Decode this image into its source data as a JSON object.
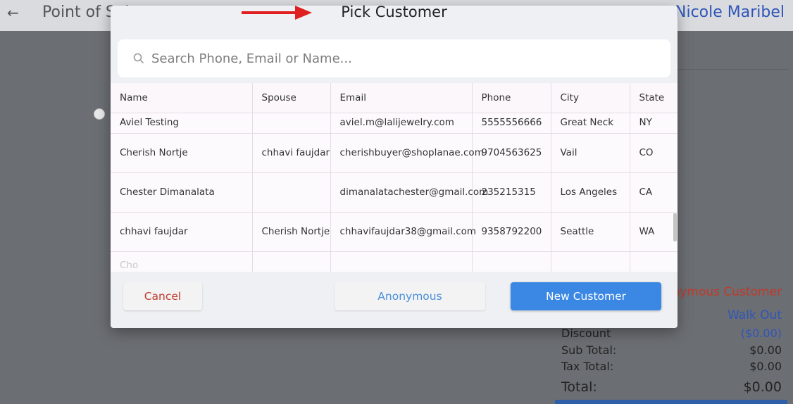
{
  "app": {
    "back_icon": "arrow-left-icon",
    "title": "Point of Sale",
    "user_name": "Nicole Maribel"
  },
  "side_panel": {
    "customer_label": "Anonymous Customer",
    "walk_out_label": "Walk Out",
    "discount_label": "Discount",
    "discount_value": "($0.00)",
    "subtotal_label": "Sub Total:",
    "subtotal_value": "$0.00",
    "tax_label": "Tax Total:",
    "tax_value": "$0.00",
    "total_label": "Total:",
    "total_value": "$0.00"
  },
  "modal": {
    "title": "Pick Customer",
    "search_placeholder": "Search Phone, Email or Name...",
    "columns": [
      "Name",
      "Spouse",
      "Email",
      "Phone",
      "City",
      "State"
    ],
    "rows": [
      {
        "name": "Aviel Testing",
        "spouse": "",
        "email": "aviel.m@lalijewelry.com",
        "phone": "5555556666",
        "city": "Great Neck",
        "state": "NY"
      },
      {
        "name": "Cherish Nortje",
        "spouse": "chhavi faujdar",
        "email": "cherishbuyer@shoplanae.com",
        "phone": "9704563625",
        "city": "Vail",
        "state": "CO"
      },
      {
        "name": "Chester Dimanalata",
        "spouse": "",
        "email": "dimanalatachester@gmail.com",
        "phone": "235215315",
        "city": "Los Angeles",
        "state": "CA"
      },
      {
        "name": "chhavi faujdar",
        "spouse": "Cherish Nortje",
        "email": "chhavifaujdar38@gmail.com",
        "phone": "9358792200",
        "city": "Seattle",
        "state": "WA"
      },
      {
        "name": "Cho",
        "spouse": "",
        "email": "",
        "phone": "",
        "city": "",
        "state": ""
      }
    ],
    "buttons": {
      "cancel": "Cancel",
      "anonymous": "Anonymous",
      "new_customer": "New Customer"
    }
  },
  "colors": {
    "annotation_arrow": "#e02020",
    "primary_button": "#3a87e4",
    "cancel_text": "#c03a2b",
    "link_blue": "#2f55b8"
  }
}
